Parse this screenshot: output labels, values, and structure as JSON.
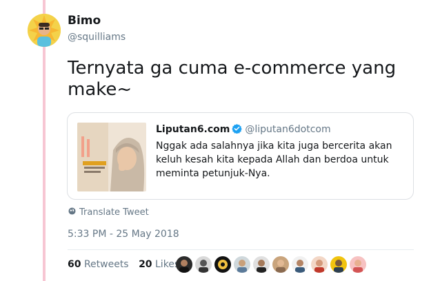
{
  "author": {
    "name": "Bimo",
    "handle": "@squilliams"
  },
  "tweet": {
    "text": "Ternyata ga cuma e-commerce yang make~"
  },
  "quoted": {
    "name": "Liputan6.com",
    "handle": "@liputan6dotcom",
    "text": "Nggak ada salahnya jika kita juga bercerita akan keluh kesah kita kepada Allah dan berdoa untuk meminta petunjuk-Nya."
  },
  "translate_label": "Translate Tweet",
  "timestamp": "5:33 PM - 25 May 2018",
  "stats": {
    "retweets_count": "60",
    "retweets_label": "Retweets",
    "likes_count": "20",
    "likes_label": "Likes"
  },
  "liker_count": 10,
  "colors": {
    "thread_line": "#f7c6d3",
    "verified": "#1da1f2",
    "secondary_text": "#657786"
  }
}
